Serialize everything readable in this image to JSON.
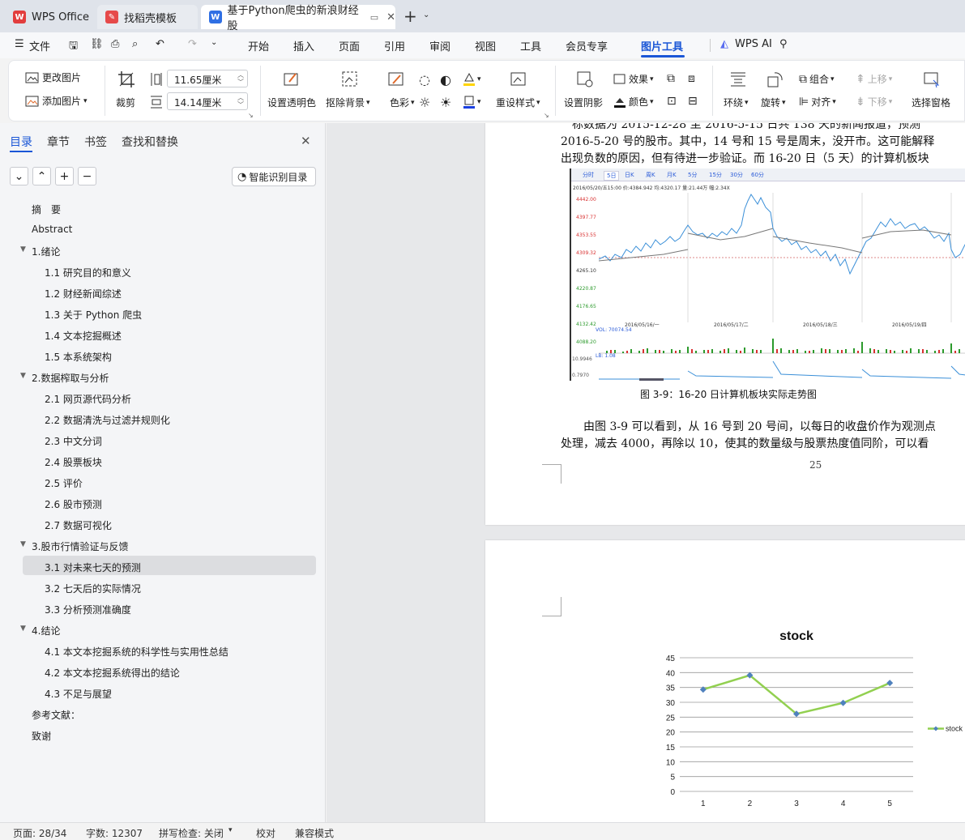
{
  "tabs": [
    {
      "label": "WPS Office"
    },
    {
      "label": "找稻壳模板"
    },
    {
      "label": "基于Python爬虫的新浪财经股"
    }
  ],
  "menu": {
    "file": "文件",
    "items": [
      "开始",
      "插入",
      "页面",
      "引用",
      "审阅",
      "视图",
      "工具",
      "会员专享",
      "图片工具"
    ],
    "wps_ai": "WPS AI"
  },
  "ribbon": {
    "change_pic": "更改图片",
    "add_pic": "添加图片",
    "crop": "裁剪",
    "width_value": "11.65厘米",
    "height_value": "14.14厘米",
    "transparent": "设置透明色",
    "remove_bg": "抠除背景",
    "color": "色彩",
    "preset_style": "重设样式",
    "shadow": "设置阴影",
    "effect": "效果",
    "fill_color": "颜色",
    "wrap": "环绕",
    "rotate": "旋转",
    "group": "组合",
    "align": "对齐",
    "move_up": "上移",
    "move_down": "下移",
    "selection_pane": "选择窗格"
  },
  "sidebar": {
    "tabs": [
      "目录",
      "章节",
      "书签",
      "查找和替换"
    ],
    "smart_btn": "智能识别目录",
    "toc": [
      {
        "label": "摘　要",
        "level": 0
      },
      {
        "label": "Abstract",
        "level": 0
      },
      {
        "label": "1.绪论",
        "level": 1
      },
      {
        "label": "1.1  研究目的和意义",
        "level": 2
      },
      {
        "label": "1.2  财经新闻综述",
        "level": 2
      },
      {
        "label": "1.3  关于 Python 爬虫",
        "level": 2
      },
      {
        "label": "1.4  文本挖掘概述",
        "level": 2
      },
      {
        "label": "1.5 本系统架构",
        "level": 2
      },
      {
        "label": "2.数据榨取与分析",
        "level": 1
      },
      {
        "label": "2.1  网页源代码分析",
        "level": 2
      },
      {
        "label": "2.2  数据清洗与过滤并规则化",
        "level": 2
      },
      {
        "label": "2.3  中文分词",
        "level": 2
      },
      {
        "label": "2.4  股票板块",
        "level": 2
      },
      {
        "label": "2.5  评价",
        "level": 2
      },
      {
        "label": "2.6  股市预测",
        "level": 2
      },
      {
        "label": "2.7  数据可视化",
        "level": 2
      },
      {
        "label": "3.股市行情验证与反馈",
        "level": 1
      },
      {
        "label": "3.1  对未来七天的预测",
        "level": 2,
        "selected": true
      },
      {
        "label": "3.2  七天后的实际情况",
        "level": 2
      },
      {
        "label": "3.3  分析预测准确度",
        "level": 2
      },
      {
        "label": "4.结论",
        "level": 1
      },
      {
        "label": "4.1  本文本挖掘系统的科学性与实用性总结",
        "level": 2
      },
      {
        "label": "4.2  本文本挖掘系统得出的结论",
        "level": 2
      },
      {
        "label": "4.3  不足与展望",
        "level": 2
      },
      {
        "label": "参考文献：",
        "level": 0
      },
      {
        "label": "致谢",
        "level": 0
      }
    ]
  },
  "document": {
    "line1": "　标数据为 2015-12-28 至 2016-5-15 日共 138 天的新闻报道，预测",
    "line2": "2016-5-20 号的股市。其中，14 号和 15 号是周末，没开市。这可能解释",
    "line3": "出现负数的原因，但有待进一步验证。而 16-20 日（5 天）的计算机板块",
    "figure_caption": "图 3-9：16-20 日计算机板块实际走势图",
    "para1": "由图 3-9 可以看到，从 16 号到 20 号间，以每日的收盘价作为观测点",
    "para2": "处理，减去 4000，再除以 10，使其的数量级与股票热度值同阶，可以看",
    "page_number": "25",
    "stock_chart": {
      "tabs": [
        "分时",
        "5日",
        "日K",
        "周K",
        "月K",
        "5分",
        "15分",
        "30分",
        "60分"
      ],
      "header": "2016/05/20/五15:00 价:4384.942 均:4320.17 量:21.44万 幅:2.34X",
      "price_ticks": [
        "4442.00",
        "4397.77",
        "4353.55",
        "4309.32",
        "4265.10",
        "4220.87",
        "4176.65",
        "4132.42",
        "4088.20"
      ],
      "date_labels": [
        "2016/05/16/一",
        "2016/05/17/二",
        "2016/05/18/三",
        "2016/05/19/四"
      ],
      "vol_label": "VOL: 70074.54",
      "lb_label": "LB: 1.08",
      "lb_top": "10.9946",
      "lb_bottom": "0.7970"
    }
  },
  "chart_data": {
    "type": "line",
    "title": "stock",
    "categories": [
      "1",
      "2",
      "3",
      "4",
      "5"
    ],
    "series": [
      {
        "name": "stock",
        "values": [
          34.3,
          39.1,
          26.1,
          29.8,
          36.5
        ],
        "color": "#92d050"
      }
    ],
    "ylim": [
      0,
      45
    ],
    "yticks": [
      0,
      5,
      10,
      15,
      20,
      25,
      30,
      35,
      40,
      45
    ],
    "grid": true,
    "legend": "right"
  },
  "status": {
    "page": "页面: 28/34",
    "words": "字数: 12307",
    "spell": "拼写检查: 关闭",
    "proof": "校对",
    "compat": "兼容模式"
  }
}
